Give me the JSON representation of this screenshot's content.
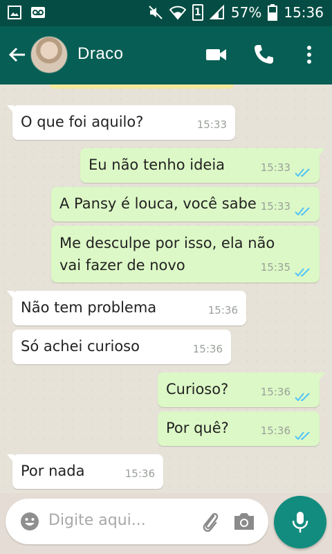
{
  "status_bar": {
    "battery_percent": "57%",
    "time": "15:36",
    "sim_label": "1",
    "icons": [
      "image-icon",
      "voicemail-icon",
      "mute-icon",
      "wifi-icon",
      "sim-icon",
      "signal-icon",
      "battery-icon"
    ]
  },
  "header": {
    "contact_name": "Draco",
    "icons": [
      "back-arrow-icon",
      "avatar",
      "video-call-icon",
      "phone-icon",
      "more-vert-icon"
    ]
  },
  "messages": [
    {
      "direction": "in",
      "text": "O que foi aquilo?",
      "time": "15:33"
    },
    {
      "direction": "out",
      "text": "Eu não tenho ideia",
      "time": "15:33",
      "status": "read"
    },
    {
      "direction": "out",
      "text": "A Pansy é louca, você sabe",
      "time": "15:33",
      "status": "read"
    },
    {
      "direction": "out",
      "line1": "Me desculpe por isso, ela não",
      "line2": "vai fazer de novo",
      "time": "15:35",
      "status": "read"
    },
    {
      "direction": "in",
      "text": "Não tem problema",
      "time": "15:36"
    },
    {
      "direction": "in",
      "text": "Só achei curioso",
      "time": "15:36"
    },
    {
      "direction": "out",
      "text": "Curioso?",
      "time": "15:36",
      "status": "read"
    },
    {
      "direction": "out",
      "text": "Por quê?",
      "time": "15:36",
      "status": "read"
    },
    {
      "direction": "in",
      "text": "Por nada",
      "time": "15:36"
    }
  ],
  "composer": {
    "placeholder": "Digite aqui...",
    "icons": [
      "emoji-icon",
      "attach-icon",
      "camera-icon",
      "mic-icon"
    ]
  },
  "colors": {
    "status_bar": "#054d44",
    "app_bar": "#075e54",
    "outgoing_bubble": "#dcf8c6",
    "incoming_bubble": "#ffffff",
    "read_ticks": "#4fc3f7",
    "mic_button": "#128c7e"
  }
}
